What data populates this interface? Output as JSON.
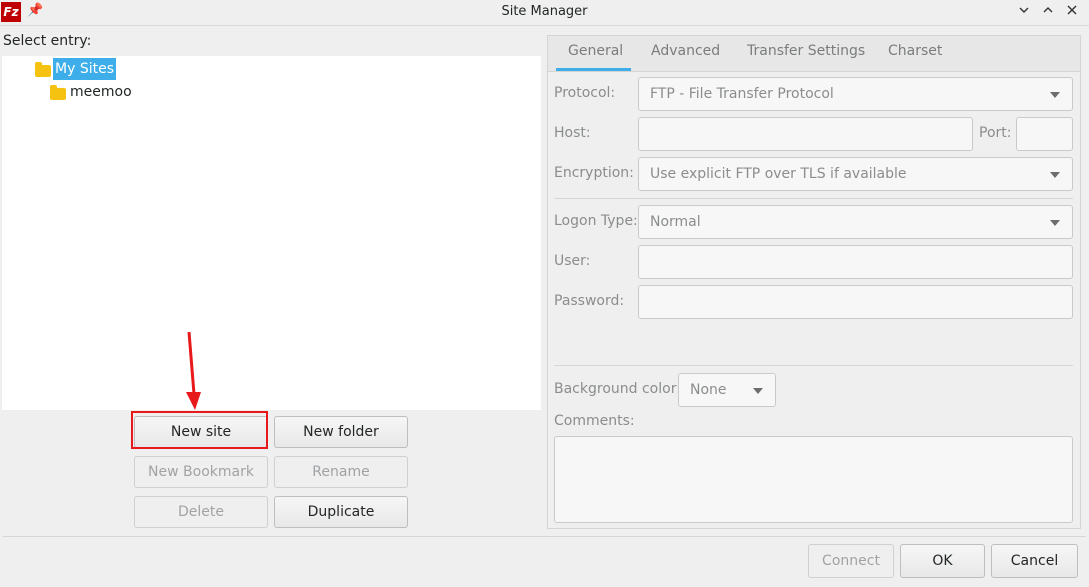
{
  "window": {
    "title": "Site Manager",
    "app_icon_text": "Fz",
    "controls": [
      "chevron-down-icon",
      "chevron-up-icon",
      "close-icon"
    ]
  },
  "left": {
    "select_label": "Select entry:",
    "tree": [
      {
        "label": "My Sites",
        "expanded": true,
        "selected": true
      },
      {
        "label": "meemoo",
        "expanded": false,
        "selected": false
      }
    ],
    "buttons": {
      "new_site": "New site",
      "new_folder": "New folder",
      "new_bookmark": "New Bookmark",
      "rename": "Rename",
      "delete": "Delete",
      "duplicate": "Duplicate"
    }
  },
  "tabs": [
    "General",
    "Advanced",
    "Transfer Settings",
    "Charset"
  ],
  "general": {
    "protocol_label": "Protocol:",
    "protocol_value": "FTP - File Transfer Protocol",
    "host_label": "Host:",
    "host_value": "",
    "port_label": "Port:",
    "port_value": "",
    "encryption_label": "Encryption:",
    "encryption_value": "Use explicit FTP over TLS if available",
    "logon_label": "Logon Type:",
    "logon_value": "Normal",
    "user_label": "User:",
    "user_value": "",
    "password_label": "Password:",
    "password_value": "",
    "bgcolor_label": "Background color:",
    "bgcolor_value": "None",
    "comments_label": "Comments:",
    "comments_value": ""
  },
  "footer": {
    "connect": "Connect",
    "ok": "OK",
    "cancel": "Cancel"
  },
  "colors": {
    "accent": "#3daee9",
    "highlight": "#e8191b",
    "folder": "#f5c211"
  }
}
